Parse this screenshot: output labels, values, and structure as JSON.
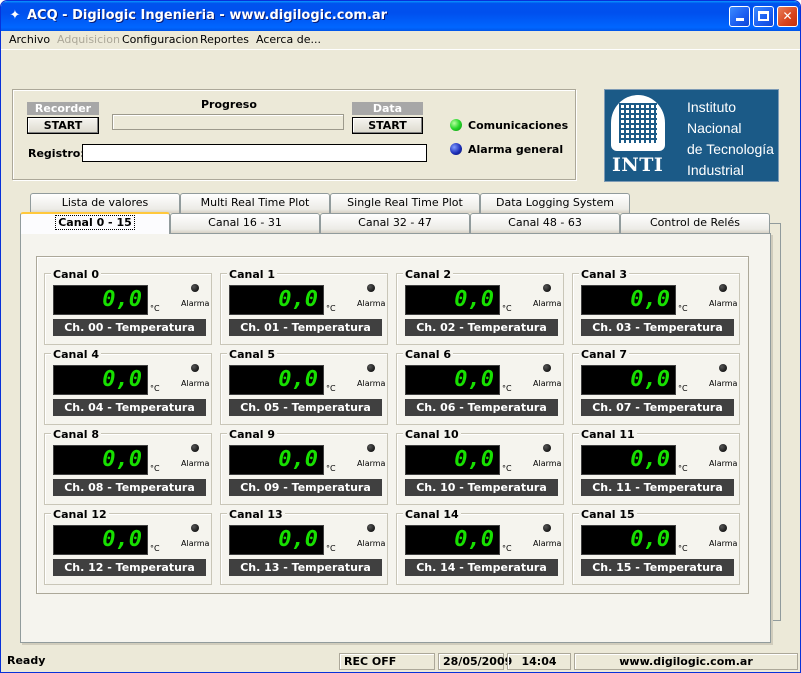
{
  "window": {
    "title": "ACQ - Digilogic Ingenieria - www.digilogic.com.ar",
    "app_icon": "acq-app-icon"
  },
  "menu": {
    "items": [
      {
        "label": "Archivo",
        "enabled": true
      },
      {
        "label": "Adquisicion",
        "enabled": false
      },
      {
        "label": "Configuracion",
        "enabled": true
      },
      {
        "label": "Reportes",
        "enabled": true
      },
      {
        "label": "Acerca de...",
        "enabled": true
      }
    ]
  },
  "controls": {
    "recorder": {
      "caption": "Recorder",
      "button": "START"
    },
    "data_logger": {
      "caption": "Data Logger",
      "button": "START"
    },
    "progress_label": "Progreso",
    "progress": 0,
    "registro_label": "Registro:",
    "registro_value": "",
    "indicators": [
      {
        "label": "Comunicaciones",
        "color": "#27d62a"
      },
      {
        "label": "Alarma general",
        "color": "#1d2fb8"
      }
    ]
  },
  "logo": {
    "abbr": "INTI",
    "lines": [
      "Instituto",
      "Nacional",
      "de Tecnología",
      "Industrial"
    ],
    "background": "#1b5a87"
  },
  "tabs": {
    "back_row": [
      "Lista de valores",
      "Multi Real Time Plot",
      "Single Real Time Plot",
      "Data Logging System"
    ],
    "front_row": [
      "Canal 0 - 15",
      "Canal 16 - 31",
      "Canal 32 - 47",
      "Canal 48 - 63",
      "Control de Relés"
    ],
    "active": "Canal 0 - 15"
  },
  "channels": [
    {
      "title": "Canal  0",
      "value": "0,0",
      "unit": "°C",
      "alarm": "Alarma",
      "name": "Ch. 00 - Temperatura"
    },
    {
      "title": "Canal  1",
      "value": "0,0",
      "unit": "°C",
      "alarm": "Alarma",
      "name": "Ch. 01 - Temperatura"
    },
    {
      "title": "Canal  2",
      "value": "0,0",
      "unit": "°C",
      "alarm": "Alarma",
      "name": "Ch. 02 - Temperatura"
    },
    {
      "title": "Canal  3",
      "value": "0,0",
      "unit": "°C",
      "alarm": "Alarma",
      "name": "Ch. 03 - Temperatura"
    },
    {
      "title": "Canal  4",
      "value": "0,0",
      "unit": "°C",
      "alarm": "Alarma",
      "name": "Ch. 04 - Temperatura"
    },
    {
      "title": "Canal  5",
      "value": "0,0",
      "unit": "°C",
      "alarm": "Alarma",
      "name": "Ch. 05 - Temperatura"
    },
    {
      "title": "Canal  6",
      "value": "0,0",
      "unit": "°C",
      "alarm": "Alarma",
      "name": "Ch. 06 - Temperatura"
    },
    {
      "title": "Canal  7",
      "value": "0,0",
      "unit": "°C",
      "alarm": "Alarma",
      "name": "Ch. 07 - Temperatura"
    },
    {
      "title": "Canal  8",
      "value": "0,0",
      "unit": "°C",
      "alarm": "Alarma",
      "name": "Ch. 08 - Temperatura"
    },
    {
      "title": "Canal  9",
      "value": "0,0",
      "unit": "°C",
      "alarm": "Alarma",
      "name": "Ch. 09 - Temperatura"
    },
    {
      "title": "Canal  10",
      "value": "0,0",
      "unit": "°C",
      "alarm": "Alarma",
      "name": "Ch. 10 - Temperatura"
    },
    {
      "title": "Canal  11",
      "value": "0,0",
      "unit": "°C",
      "alarm": "Alarma",
      "name": "Ch. 11 - Temperatura"
    },
    {
      "title": "Canal  12",
      "value": "0,0",
      "unit": "°C",
      "alarm": "Alarma",
      "name": "Ch. 12 - Temperatura"
    },
    {
      "title": "Canal  13",
      "value": "0,0",
      "unit": "°C",
      "alarm": "Alarma",
      "name": "Ch. 13 - Temperatura"
    },
    {
      "title": "Canal  14",
      "value": "0,0",
      "unit": "°C",
      "alarm": "Alarma",
      "name": "Ch. 14 - Temperatura"
    },
    {
      "title": "Canal  15",
      "value": "0,0",
      "unit": "°C",
      "alarm": "Alarma",
      "name": "Ch. 15 - Temperatura"
    }
  ],
  "statusbar": {
    "status": "Ready",
    "rec": "REC OFF",
    "date": "28/05/2009",
    "time": "14:04",
    "url": "www.digilogic.com.ar"
  }
}
